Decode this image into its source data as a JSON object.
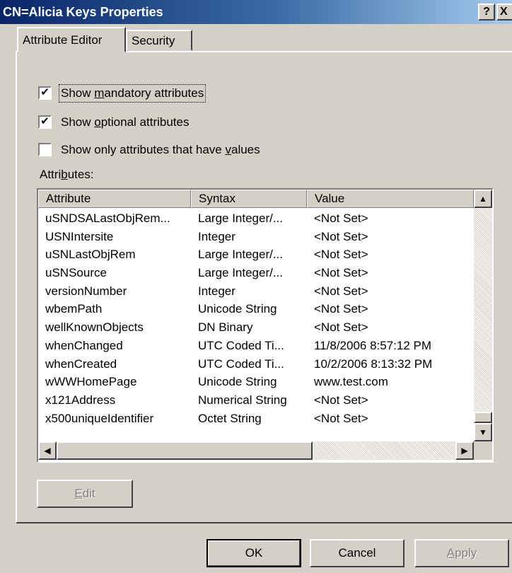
{
  "window": {
    "title": "CN=Alicia Keys Properties",
    "help_label": "?",
    "close_label": "X"
  },
  "tabs": [
    {
      "label": "Attribute Editor"
    },
    {
      "label": "Security"
    }
  ],
  "options": {
    "mandatory": {
      "checked": true,
      "pre": "Show ",
      "key": "m",
      "post": "andatory attributes"
    },
    "optional": {
      "checked": true,
      "pre": "Show ",
      "key": "o",
      "post": "ptional attributes"
    },
    "only_values": {
      "checked": false,
      "pre": "Show only attributes that have ",
      "key": "v",
      "post": "alues"
    }
  },
  "attributes_label": {
    "pre": "Attri",
    "key": "b",
    "post": "utes:"
  },
  "table": {
    "columns": [
      "Attribute",
      "Syntax",
      "Value"
    ],
    "rows": [
      [
        "uSNDSALastObjRem...",
        "Large Integer/...",
        "<Not Set>"
      ],
      [
        "USNIntersite",
        "Integer",
        "<Not Set>"
      ],
      [
        "uSNLastObjRem",
        "Large Integer/...",
        "<Not Set>"
      ],
      [
        "uSNSource",
        "Large Integer/...",
        "<Not Set>"
      ],
      [
        "versionNumber",
        "Integer",
        "<Not Set>"
      ],
      [
        "wbemPath",
        "Unicode String",
        "<Not Set>"
      ],
      [
        "wellKnownObjects",
        "DN Binary",
        "<Not Set>"
      ],
      [
        "whenChanged",
        "UTC Coded Ti...",
        "11/8/2006 8:57:12 PM"
      ],
      [
        "whenCreated",
        "UTC Coded Ti...",
        "10/2/2006 8:13:32 PM"
      ],
      [
        "wWWHomePage",
        "Unicode String",
        "www.test.com"
      ],
      [
        "x121Address",
        "Numerical String",
        "<Not Set>"
      ],
      [
        "x500uniqueIdentifier",
        "Octet String",
        "<Not Set>"
      ]
    ]
  },
  "buttons": {
    "edit": {
      "key": "E",
      "post": "dit"
    },
    "ok": "OK",
    "cancel": "Cancel",
    "apply": {
      "key": "A",
      "post": "pply"
    }
  },
  "icons": {
    "checkmark": "✔",
    "scroll_up": "▲",
    "scroll_down": "▼",
    "scroll_left": "◀",
    "scroll_right": "▶"
  }
}
